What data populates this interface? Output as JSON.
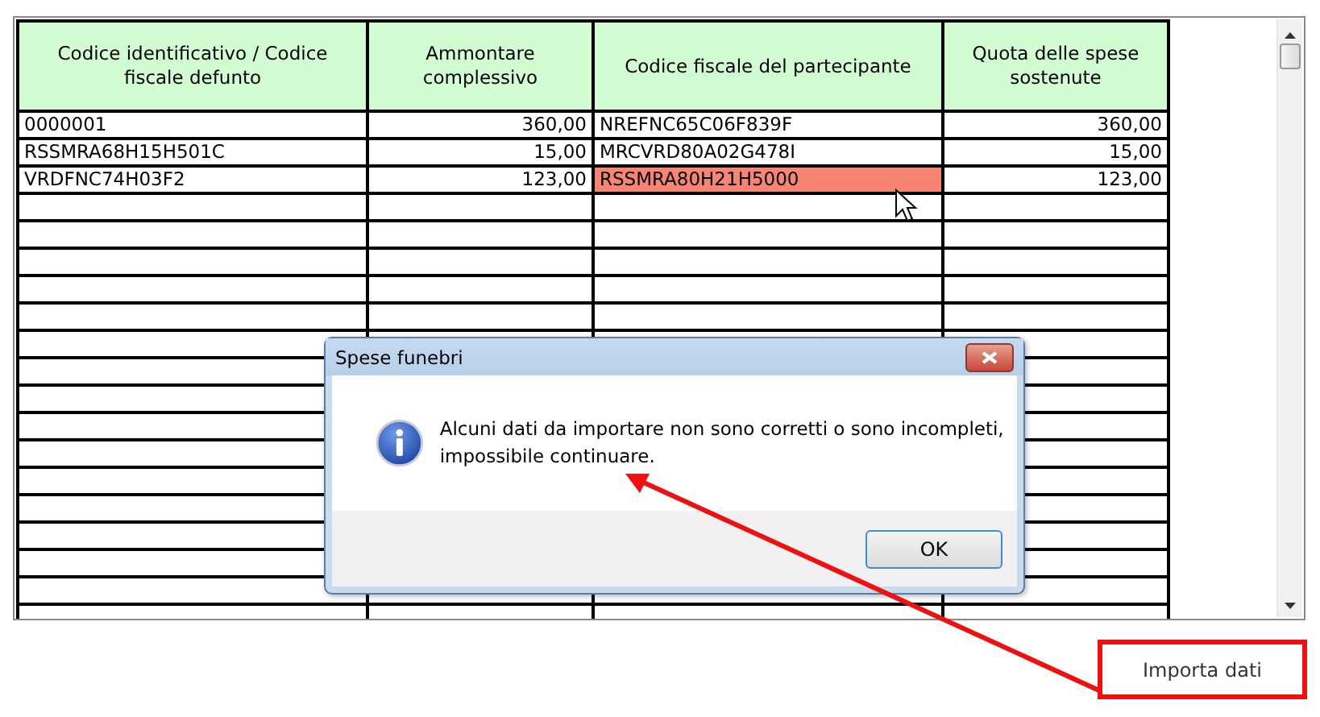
{
  "table": {
    "columns": [
      {
        "label": "Codice identificativo / Codice fiscale defunto",
        "kind": "text"
      },
      {
        "label": "Ammontare complessivo",
        "kind": "amount"
      },
      {
        "label": "Codice fiscale del partecipante",
        "kind": "text"
      },
      {
        "label": "Quota delle spese sostenute",
        "kind": "amount"
      }
    ],
    "rows": [
      {
        "cells": [
          {
            "text": "0000001",
            "invalid": false
          },
          {
            "text": "360,00",
            "invalid": false
          },
          {
            "text": "NREFNC65C06F839F",
            "invalid": false
          },
          {
            "text": "360,00",
            "invalid": false
          }
        ]
      },
      {
        "cells": [
          {
            "text": "RSSMRA68H15H501C",
            "invalid": false
          },
          {
            "text": "15,00",
            "invalid": false
          },
          {
            "text": "MRCVRD80A02G478I",
            "invalid": false
          },
          {
            "text": "15,00",
            "invalid": false
          }
        ]
      },
      {
        "cells": [
          {
            "text": "VRDFNC74H03F2",
            "invalid": false
          },
          {
            "text": "123,00",
            "invalid": false
          },
          {
            "text": "RSSMRA80H21H5000",
            "invalid": true
          },
          {
            "text": "123,00",
            "invalid": false
          }
        ]
      }
    ]
  },
  "dialog": {
    "title": "Spese funebri",
    "message": "Alcuni dati da importare non sono corretti o sono incompleti, impossibile continuare.",
    "buttons": [
      "OK"
    ]
  },
  "import_button": {
    "label": "Importa dati"
  }
}
